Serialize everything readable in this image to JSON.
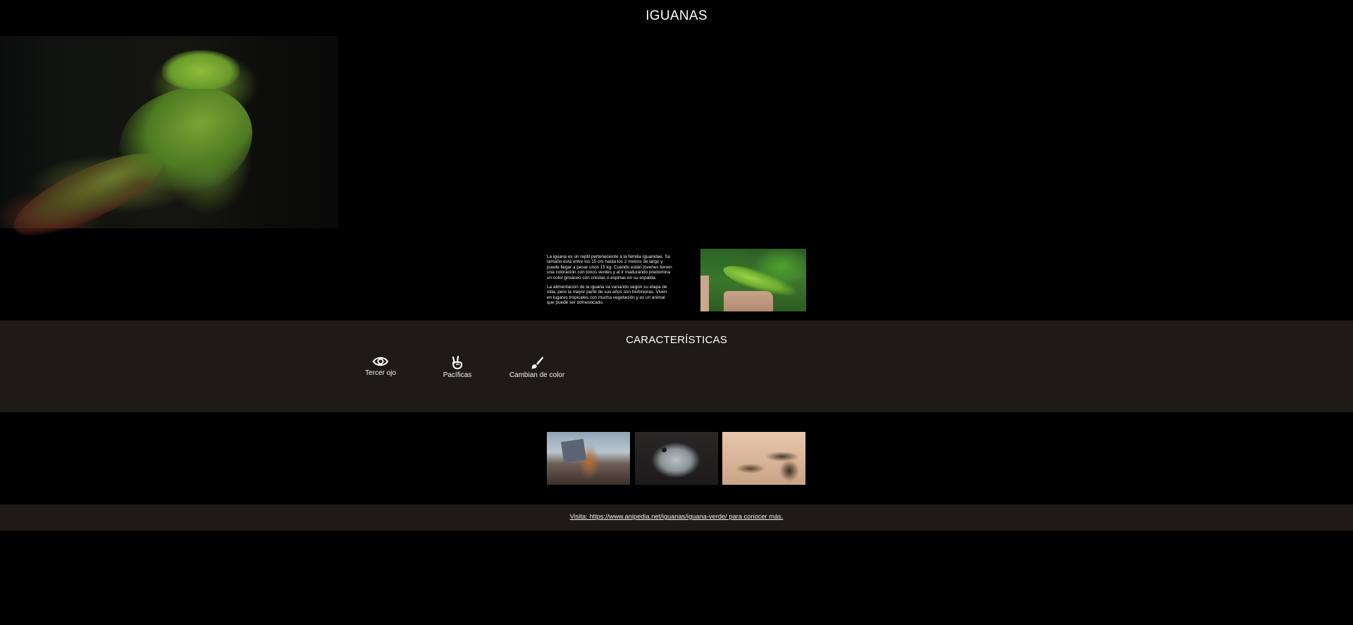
{
  "header": {
    "title": "IGUANAS"
  },
  "intro": {
    "paragraphs": [
      "La iguana es un reptil perteneciente a la familia Iguanidae. Su tamaño está entre los 15 cm hasta los 2 metros de largo y puede llegar a pesar unos 15 kg. Cuando están jóvenes tienen una coloración con tonos verdes y al ir madurando predomina un color grisáceo con crestas o espinas en su espalda.",
      "La alimentación de la iguana va variando según su etapa de vida, pero la mayor parte de sus años son herbívoras. Viven en lugares tropicales con mucha vegetación y es un animal que puede ser domesticado."
    ]
  },
  "features": {
    "title": "CARACTERÍSTICAS",
    "items": [
      {
        "label": "Tercer ojo",
        "icon": "eye-icon"
      },
      {
        "label": "Pacíficas",
        "icon": "peace-hand-icon"
      },
      {
        "label": "Cambian de color",
        "icon": "paintbrush-icon"
      }
    ]
  },
  "footer": {
    "text": "Visita: https://www.anipedia.net/iguanas/iguana-verde/ para conocer más."
  }
}
